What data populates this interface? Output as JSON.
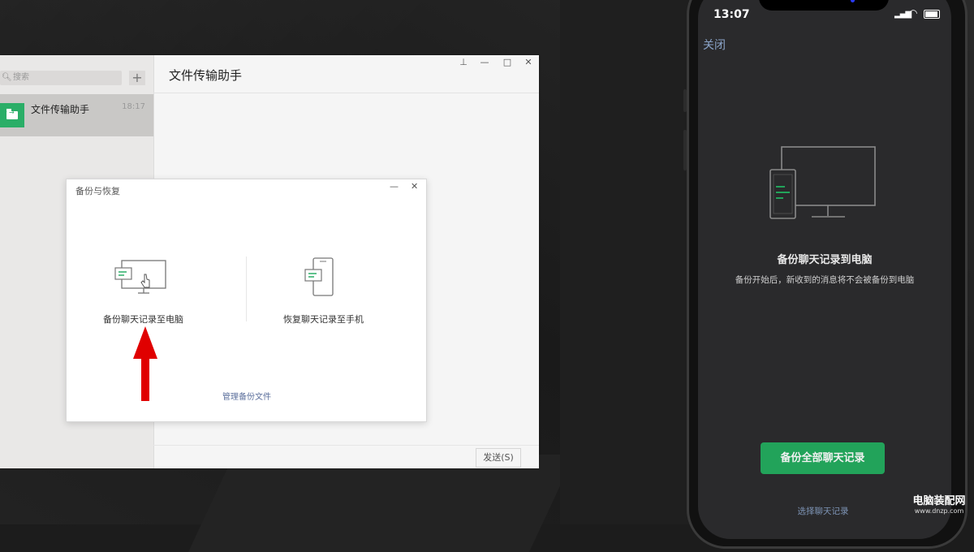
{
  "pc": {
    "search_placeholder": "搜索",
    "add_label": "+",
    "chat_name": "文件传输助手",
    "chat_time": "18:17",
    "title": "文件传输助手",
    "controls": {
      "pin": "⊥",
      "minimize": "—",
      "maximize": "□",
      "close": "✕"
    },
    "send_button": "发送(S)"
  },
  "dialog": {
    "title": "备份与恢复",
    "minimize": "—",
    "close": "✕",
    "option_backup": "备份聊天记录至电脑",
    "option_restore": "恢复聊天记录至手机",
    "manage_link": "管理备份文件"
  },
  "phone": {
    "time": "13:07",
    "close": "关闭",
    "title": "备份聊天记录到电脑",
    "subtitle": "备份开始后，新收到的消息将不会被备份到电脑",
    "backup_button": "备份全部聊天记录",
    "select_link": "选择聊天记录"
  },
  "watermark": {
    "name": "电脑装配网",
    "url": "www.dnzp.com"
  },
  "colors": {
    "accent_green": "#22a35a",
    "arrow_red": "#e00000",
    "link_blue": "#5b6f9c"
  }
}
